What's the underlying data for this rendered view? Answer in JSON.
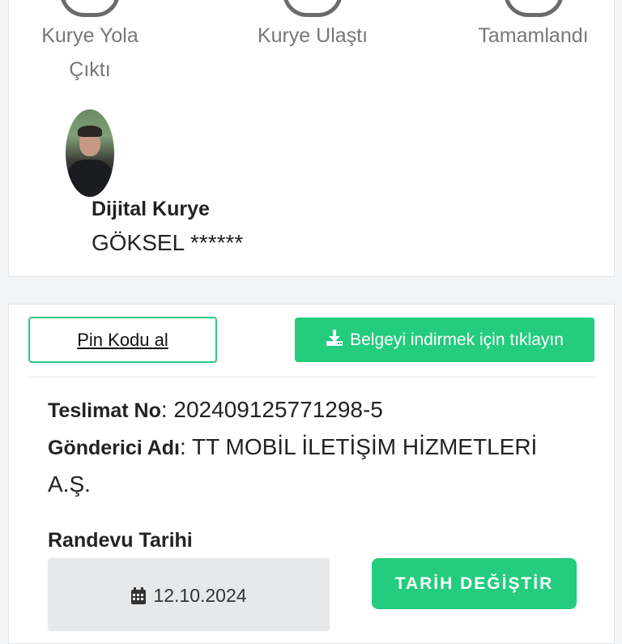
{
  "status": {
    "steps": [
      {
        "label_line1": "Kurye Yola",
        "label_line2": "Çıktı"
      },
      {
        "label_line1": "Kurye Ulaştı",
        "label_line2": ""
      },
      {
        "label_line1": "Tamamlandı",
        "label_line2": ""
      }
    ],
    "courier": {
      "role": "Dijital Kurye",
      "name": "GÖKSEL ******"
    }
  },
  "actions": {
    "pin_label": "Pin Kodu al",
    "download_label": "Belgeyi indirmek için tıklayın"
  },
  "details": {
    "delivery_no_label": "Teslimat No",
    "delivery_no_value": ": 202409125771298-5",
    "sender_label": "Gönderici Adı",
    "sender_value_line1": ": TT MOBİL İLETİŞİM HİZMETLERİ",
    "sender_value_line2": "A.Ş.",
    "appointment_label": "Randevu Tarihi",
    "appointment_date": "12.10.2024",
    "change_date_label": "TARİH DEĞİŞTİR"
  },
  "colors": {
    "accent": "#24cc7e",
    "step_ring": "#6b6b6b"
  },
  "icons": [
    "download-icon",
    "calendar-icon"
  ]
}
